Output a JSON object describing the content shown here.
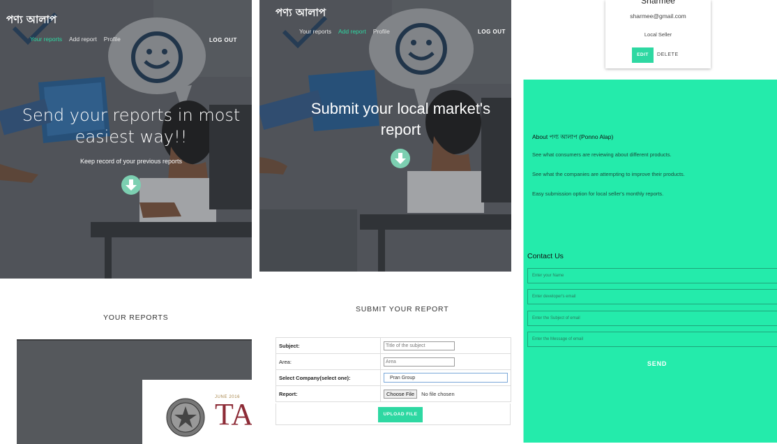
{
  "brand": "পণ্য আলাপ",
  "colors": {
    "accent": "#2ed8a2",
    "panel_green": "#24ebab",
    "hero_bg": "#585c61"
  },
  "nav": {
    "items": [
      "Your reports",
      "Add report",
      "Profile"
    ],
    "logout": "LOG OUT"
  },
  "hero_left": {
    "title_line1": "Send your reports in most",
    "title_line2": "easiest way!!",
    "subtitle": "Keep record of your previous reports",
    "active_nav": "Your reports",
    "icon": "arrow-down-circle-icon"
  },
  "hero_right": {
    "title_line1": "Submit your local market's",
    "title_line2": "report",
    "active_nav": "Add report",
    "icon": "arrow-down-circle-icon"
  },
  "reports": {
    "heading": "YOUR REPORTS",
    "doc_date": "JUNE 2016",
    "doc_title": "TAX"
  },
  "submit": {
    "heading": "SUBMIT YOUR REPORT",
    "subject_label": "Subject:",
    "subject_placeholder": "Title of the subject",
    "area_label": "Area:",
    "area_placeholder": "Area",
    "company_label": "Select Company(select one):",
    "company_selected": "Pran Group",
    "report_label": "Report:",
    "choose_file": "Choose File",
    "no_file": "No file chosen",
    "upload": "UPLOAD FILE"
  },
  "profile": {
    "name": "Sharmee",
    "email": "sharmee@gmail.com",
    "role": "Local Seller",
    "edit": "EDIT",
    "delete": "DELETE"
  },
  "about": {
    "heading": "About পণ্য আলাপ (Ponno Alap)",
    "points": [
      "See what consumers are reviewing about different products.",
      "See what the companies are attempting to improve their products.",
      "Easy submission option for local seller's monthly reports."
    ]
  },
  "contact": {
    "heading": "Contact Us",
    "name_placeholder": "Enter your Name",
    "email_placeholder": "Enter developer's email",
    "subject_placeholder": "Enter the Subject of email",
    "message_placeholder": "Enter the Message of email",
    "send": "SEND"
  }
}
